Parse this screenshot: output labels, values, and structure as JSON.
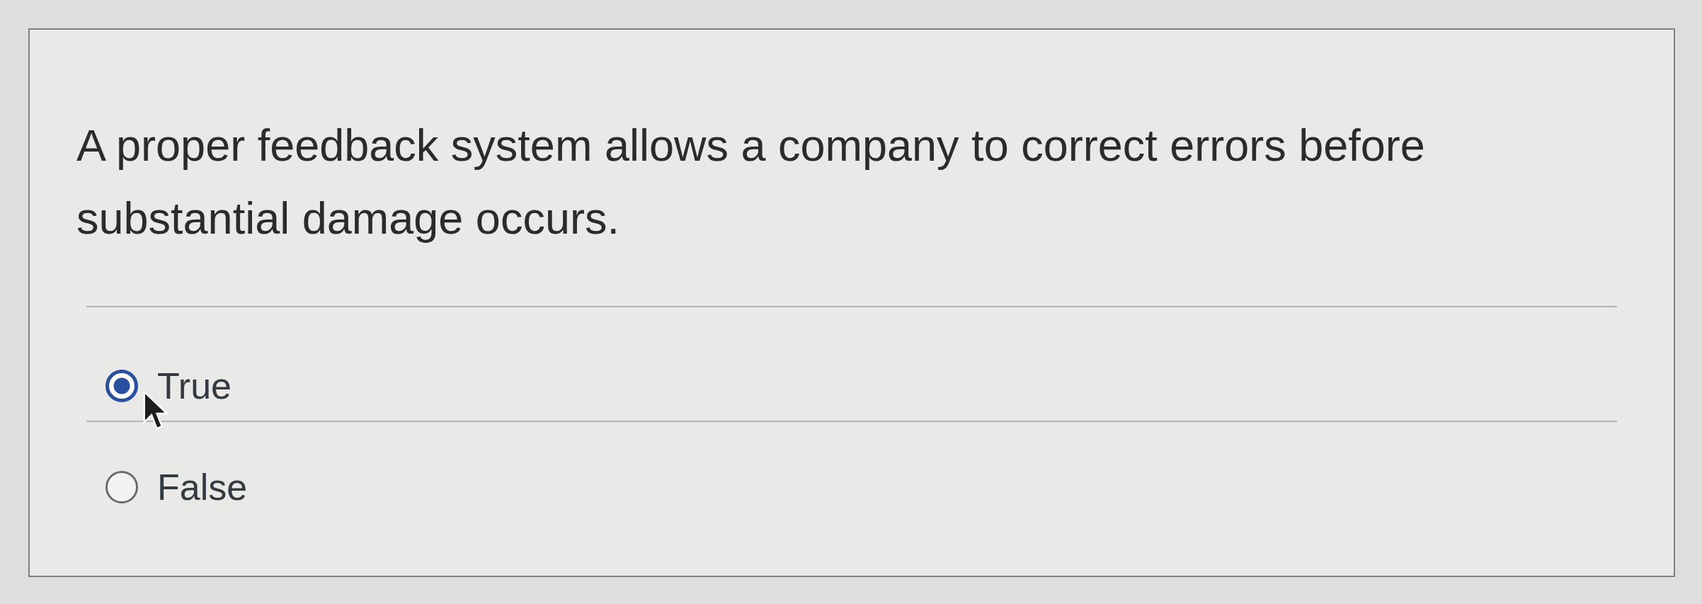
{
  "question": {
    "text": "A proper feedback system allows a company to correct errors before substantial damage occurs."
  },
  "options": [
    {
      "label": "True",
      "selected": true
    },
    {
      "label": "False",
      "selected": false
    }
  ]
}
